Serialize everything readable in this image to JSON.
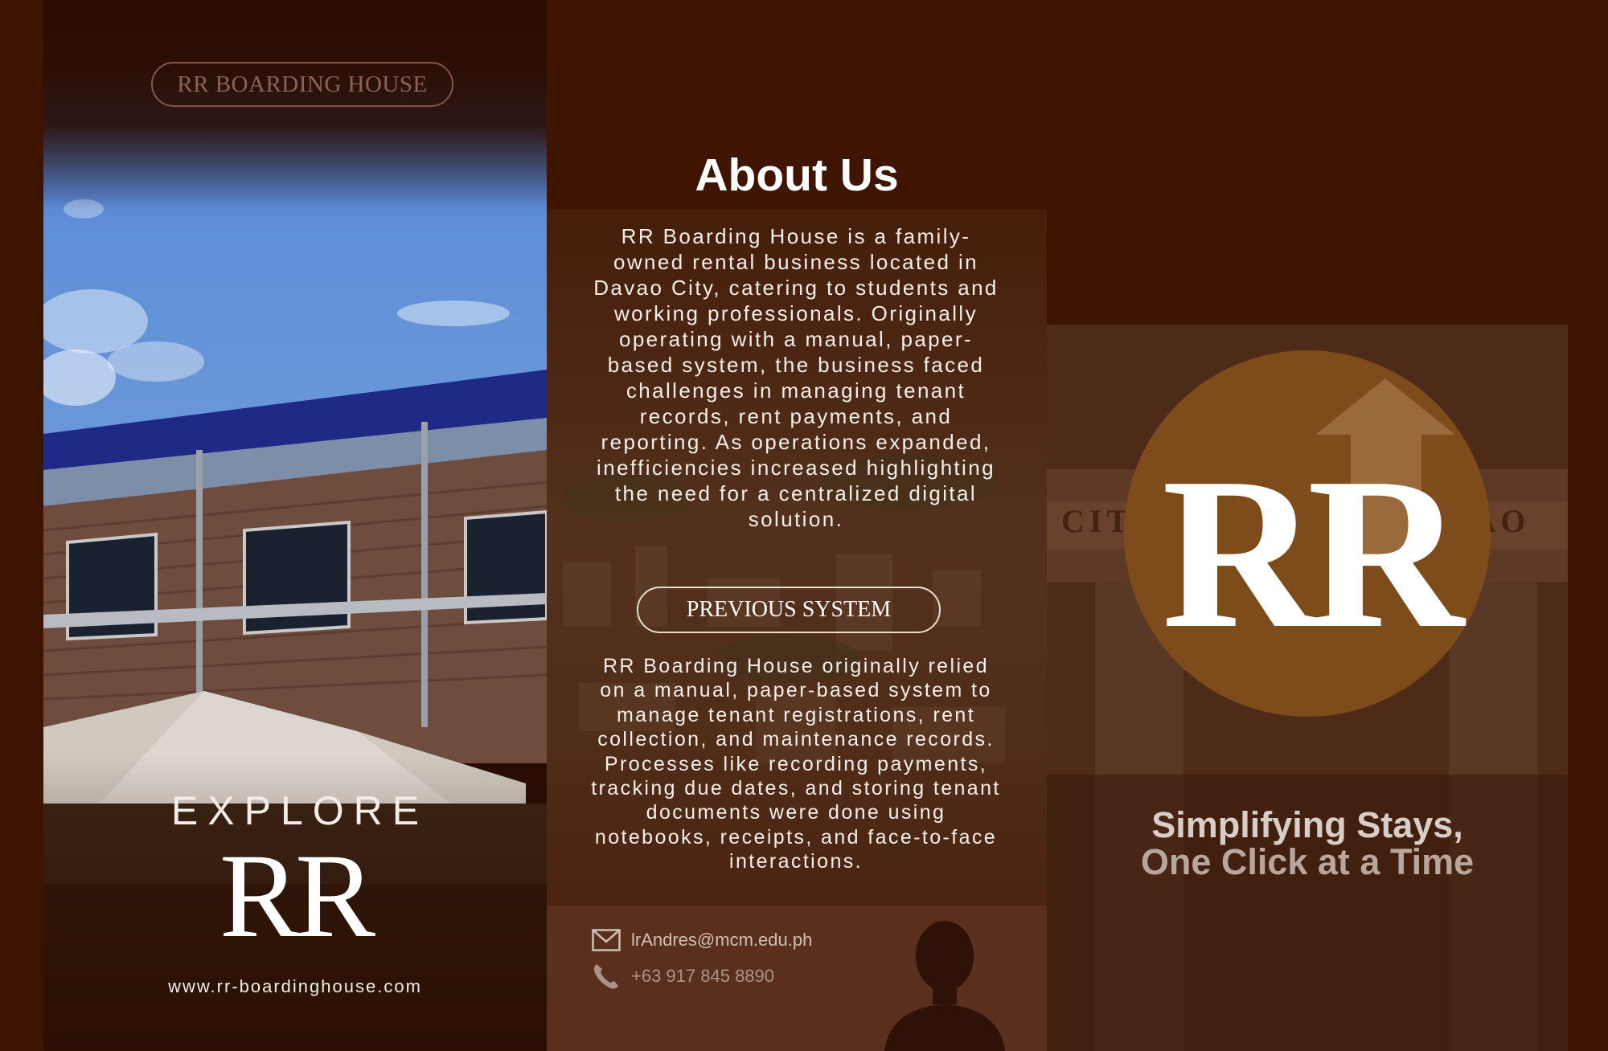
{
  "left_panel": {
    "brand": "RR BOARDING HOUSE",
    "explore": "EXPLORE",
    "monogram": "RR",
    "website": "www.rr-boardinghouse.com"
  },
  "middle_panel": {
    "title": "About Us",
    "about_text": "RR Boarding House is a family-owned rental business located in Davao City, catering to students and working professionals. Originally operating with a manual, paper-based system, the business faced challenges in managing tenant records, rent payments, and reporting. As operations expanded, inefficiencies increased highlighting the need for a centralized digital solution.",
    "previous_system_label": "PREVIOUS SYSTEM",
    "previous_system_text": "RR Boarding House originally relied on a manual, paper-based system to manage tenant registrations, rent collection, and maintenance records. Processes like recording payments, tracking due dates, and storing tenant documents were done using notebooks, receipts, and face-to-face interactions.",
    "contact": {
      "email": "lrAndres@mcm.edu.ph",
      "phone": "+63 917 845 8890",
      "email_icon": "envelope-icon",
      "phone_icon": "phone-icon"
    }
  },
  "right_panel": {
    "logo_text": "RR",
    "tagline_line1": "Simplifying Stays,",
    "tagline_line2": "One Click at a Time"
  },
  "colors": {
    "background": "#3d1400",
    "logo_circle": "#7e4b1b",
    "contact_bar": "#5a2f1e"
  }
}
